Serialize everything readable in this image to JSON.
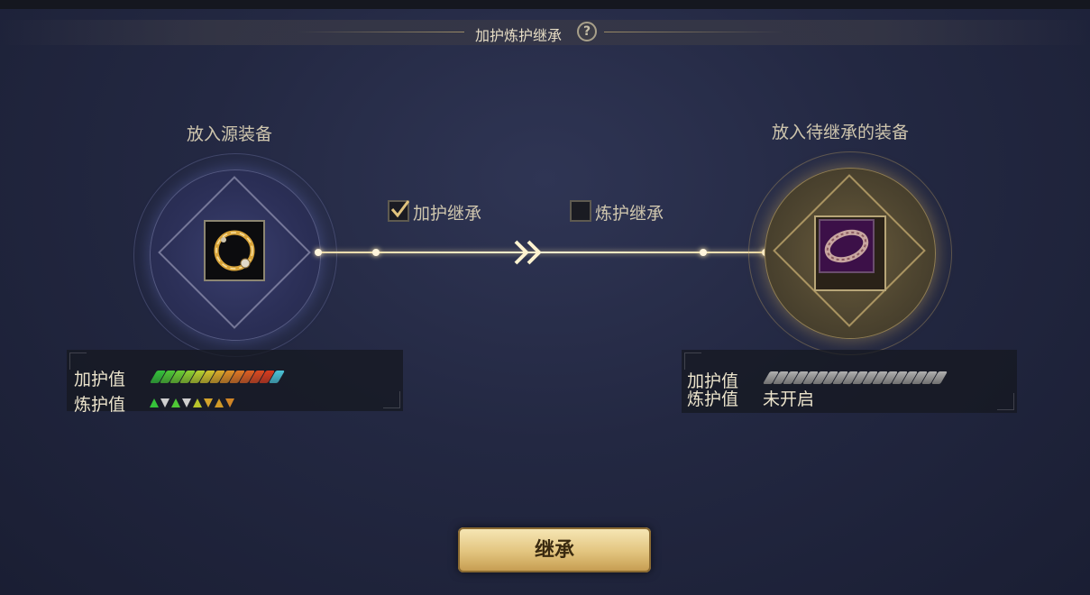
{
  "header": {
    "title": "加护炼护继承",
    "help_glyph": "?"
  },
  "source": {
    "title": "放入源装备",
    "item": "ring-icon"
  },
  "target": {
    "title": "放入待继承的装备",
    "item": "bracelet-icon"
  },
  "options": [
    {
      "label": "加护继承",
      "checked": true
    },
    {
      "label": "炼护继承",
      "checked": false
    }
  ],
  "source_stats": {
    "jiahu_label": "加护值",
    "lianhu_label": "炼护值",
    "jiahu_pip_colors": [
      "#35c23a",
      "#4fc836",
      "#6ccf33",
      "#8fd231",
      "#b8d22f",
      "#d3c42c",
      "#dcaa29",
      "#e08f26",
      "#e07724",
      "#de5f22",
      "#dc4a20",
      "#d93c1e",
      "#4cc4d8"
    ],
    "lianhu_tris": [
      {
        "dir": "up",
        "color": "#35c23a"
      },
      {
        "dir": "down",
        "color": "#cfcfcf"
      },
      {
        "dir": "up",
        "color": "#4fc836"
      },
      {
        "dir": "down",
        "color": "#cfcfcf"
      },
      {
        "dir": "up",
        "color": "#b8c42c"
      },
      {
        "dir": "down",
        "color": "#d3a42c"
      },
      {
        "dir": "up",
        "color": "#d09a28"
      },
      {
        "dir": "down",
        "color": "#d08526"
      }
    ]
  },
  "target_stats": {
    "jiahu_label": "加护值",
    "lianhu_label": "炼护值",
    "lianhu_value": "未开启",
    "jiahu_pip_count": 18
  },
  "action": {
    "label": "继承"
  },
  "colors": {
    "accent_gold": "#e2c47e",
    "line_glow": "#fff3d0"
  }
}
